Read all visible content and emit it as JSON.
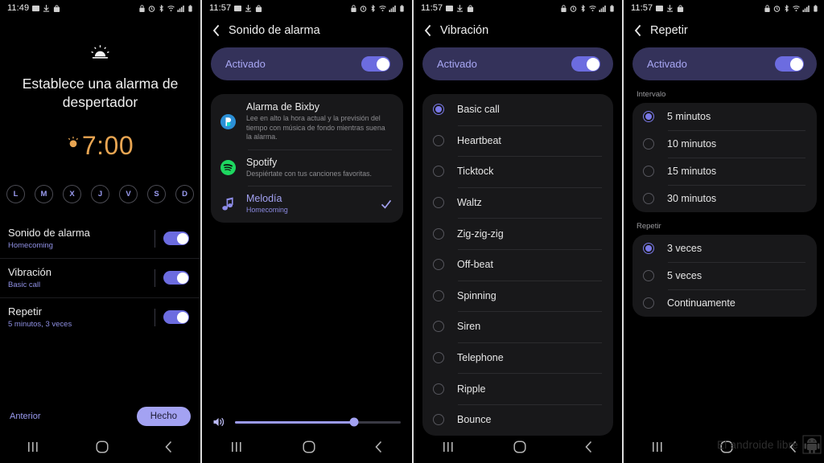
{
  "statusbar": {
    "time_left": "11:49",
    "time_others": "11:57",
    "left_icons": [
      "image-icon",
      "download-icon",
      "bag-icon"
    ],
    "right_icons": [
      "lock-icon",
      "alarm-icon",
      "bluetooth-icon",
      "wifi-icon",
      "signal-icon",
      "battery-icon"
    ]
  },
  "panel1": {
    "weather_icon": "sunrise-icon",
    "title": "Establece una alarma de despertador",
    "time_icon": "sun-icon",
    "time": "7:00",
    "days": [
      {
        "letter": "L",
        "selected": false
      },
      {
        "letter": "M",
        "selected": false
      },
      {
        "letter": "X",
        "selected": false
      },
      {
        "letter": "J",
        "selected": false
      },
      {
        "letter": "V",
        "selected": false
      },
      {
        "letter": "S",
        "selected": false
      },
      {
        "letter": "D",
        "selected": false
      }
    ],
    "rows": [
      {
        "title": "Sonido de alarma",
        "subtitle": "Homecoming",
        "toggle": "on"
      },
      {
        "title": "Vibración",
        "subtitle": "Basic call",
        "toggle": "on"
      },
      {
        "title": "Repetir",
        "subtitle": "5 minutos, 3 veces",
        "toggle": "on"
      }
    ],
    "previous_label": "Anterior",
    "done_label": "Hecho"
  },
  "panel2": {
    "back_icon": "chevron-left-icon",
    "title": "Sonido de alarma",
    "banner_label": "Activado",
    "banner_toggle": "on",
    "items": [
      {
        "icon": "bixby-icon",
        "title": "Alarma de Bixby",
        "subtitle": "Lee en alto la hora actual y la previsión del tiempo con música de fondo mientras suena la alarma.",
        "selected": false
      },
      {
        "icon": "spotify-icon",
        "title": "Spotify",
        "subtitle": "Despiértate con tus canciones favoritas.",
        "selected": false
      },
      {
        "icon": "music-note-icon",
        "title": "Melodía",
        "subtitle": "Homecoming",
        "selected": true
      }
    ],
    "volume": {
      "icon": "volume-icon",
      "value_percent": 72
    }
  },
  "panel3": {
    "back_icon": "chevron-left-icon",
    "title": "Vibración",
    "banner_label": "Activado",
    "banner_toggle": "on",
    "options": [
      {
        "label": "Basic call",
        "selected": true
      },
      {
        "label": "Heartbeat",
        "selected": false
      },
      {
        "label": "Ticktock",
        "selected": false
      },
      {
        "label": "Waltz",
        "selected": false
      },
      {
        "label": "Zig-zig-zig",
        "selected": false
      },
      {
        "label": "Off-beat",
        "selected": false
      },
      {
        "label": "Spinning",
        "selected": false
      },
      {
        "label": "Siren",
        "selected": false
      },
      {
        "label": "Telephone",
        "selected": false
      },
      {
        "label": "Ripple",
        "selected": false
      },
      {
        "label": "Bounce",
        "selected": false
      }
    ]
  },
  "panel4": {
    "back_icon": "chevron-left-icon",
    "title": "Repetir",
    "banner_label": "Activado",
    "banner_toggle": "on",
    "interval_group_label": "Intervalo",
    "interval_options": [
      {
        "label": "5 minutos",
        "selected": true
      },
      {
        "label": "10 minutos",
        "selected": false
      },
      {
        "label": "15 minutos",
        "selected": false
      },
      {
        "label": "30 minutos",
        "selected": false
      }
    ],
    "repeat_group_label": "Repetir",
    "repeat_options": [
      {
        "label": "3 veces",
        "selected": true
      },
      {
        "label": "5 veces",
        "selected": false
      },
      {
        "label": "Continuamente",
        "selected": false
      }
    ],
    "watermark": "El androide libre"
  },
  "navbar": {
    "recents_icon": "recents-icon",
    "home_icon": "home-icon",
    "back_icon": "back-icon"
  },
  "colors": {
    "accent": "#a3a2f2",
    "toggle_on": "#6c6ce0",
    "banner_bg": "#34325a",
    "time_amber": "#e8a552",
    "card_bg": "#18181a"
  }
}
